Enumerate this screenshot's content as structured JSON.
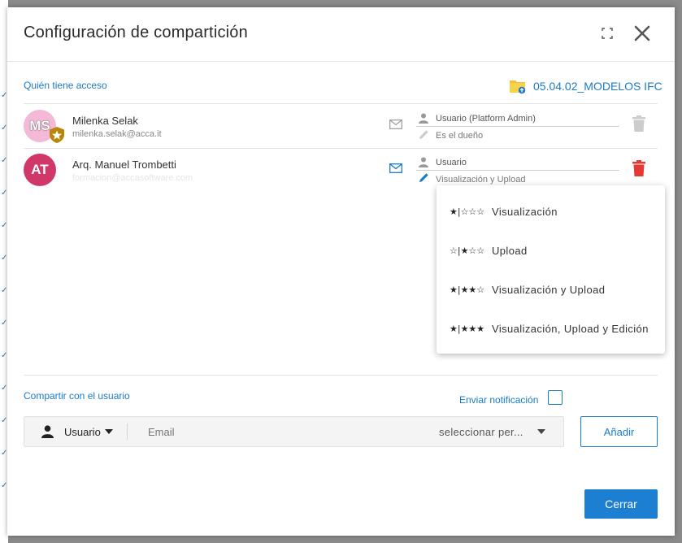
{
  "dialog": {
    "title": "Configuración de compartición"
  },
  "access": {
    "section_label": "Quién tiene acceso",
    "folder_name": "05.04.02_MODELOS IFC",
    "users": [
      {
        "initials": "MS",
        "name": "Milenka Selak",
        "email": "milenka.selak@acca.it",
        "role": "Usuario (Platform Admin)",
        "permission": "Es el dueño",
        "avatar_color": "#f4b9d6",
        "initials_color": "#ffffff"
      },
      {
        "initials": "AT",
        "name": "Arq. Manuel Trombetti",
        "email": "formacion@accasoftware.com",
        "role": "Usuario",
        "permission": "Visualización y Upload",
        "avatar_color": "#d1386a",
        "initials_color": "#ffffff"
      }
    ]
  },
  "permission_menu": {
    "options": [
      {
        "stars": "★|☆☆☆",
        "label": "Visualización"
      },
      {
        "stars": "☆|★☆☆",
        "label": "Upload"
      },
      {
        "stars": "★|★★☆",
        "label": "Visualización y Upload"
      },
      {
        "stars": "★|★★★",
        "label": "Visualización, Upload y Edición"
      }
    ]
  },
  "share": {
    "section_label": "Compartir con el usuario",
    "notify_label": "Enviar notificación",
    "type_label": "Usuario",
    "email_placeholder": "Email",
    "permission_placeholder": "seleccionar per...",
    "add_label": "Añadir"
  },
  "footer": {
    "close_label": "Cerrar"
  },
  "colors": {
    "accent": "#1a7bc7",
    "danger": "#e53935",
    "admin_badge": "#b8860b"
  },
  "icons": {
    "expand": "expand-icon",
    "close": "close-icon",
    "folder": "shared-folder-icon",
    "mail": "mail-icon",
    "person": "person-icon",
    "pencil": "pencil-icon",
    "trash": "trash-icon",
    "admin": "admin-star-badge-icon"
  }
}
